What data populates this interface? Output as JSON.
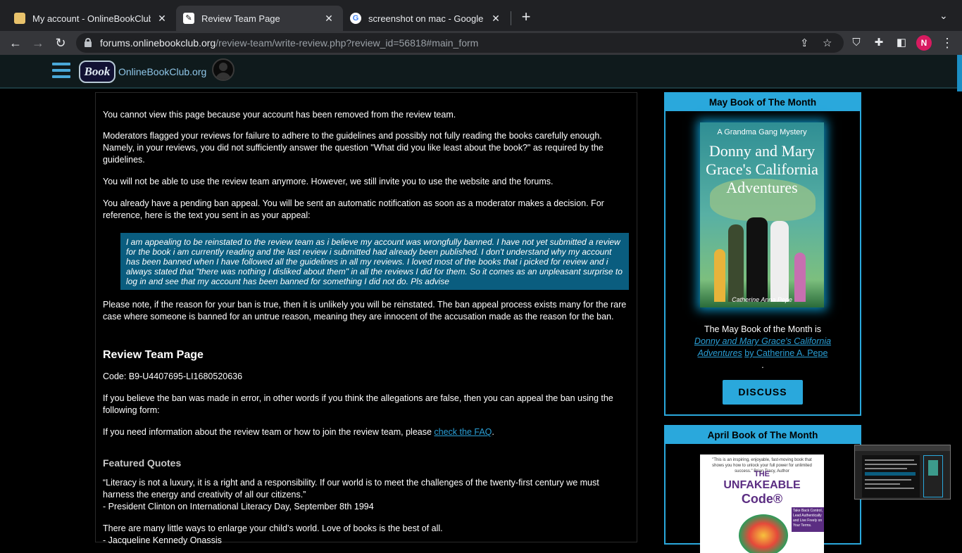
{
  "browser": {
    "tabs": [
      {
        "title": "My account - OnlineBookClub.o",
        "favicon": "book-icon",
        "active": false
      },
      {
        "title": "Review Team Page",
        "favicon": "quill-icon",
        "active": true
      },
      {
        "title": "screenshot on mac - Google S",
        "favicon": "google-icon",
        "active": false
      }
    ],
    "url_host": "forums.onlinebookclub.org",
    "url_path": "/review-team/write-review.php?review_id=56818#main_form",
    "profile_initial": "N"
  },
  "site": {
    "logo_text": "Book",
    "name": "OnlineBookClub.org"
  },
  "main": {
    "p1": "You cannot view this page because your account has been removed from the review team.",
    "p2": "Moderators flagged your reviews for failure to adhere to the guidelines and possibly not fully reading the books carefully enough. Namely, in your reviews, you did not sufficiently answer the question \"What did you like least about the book?\" as required by the guidelines.",
    "p3": "You will not be able to use the review team anymore. However, we still invite you to use the website and the forums.",
    "p4": "You already have a pending ban appeal. You will be sent an automatic notification as soon as a moderator makes a decision. For reference, here is the text you sent in as your appeal:",
    "appeal": "I am appealing to be reinstated to the review team as i believe my account was wrongfully banned. I have not yet submitted a review for the book i am currently reading and the last review i submitted had already been published. I don't understand why my account has been banned when I have followed all the guidelines in all my reviews. I loved most of the books that i picked for review and i always stated that \"there was nothing I disliked about them\" in all the reviews I did for them. So it comes as an unpleasant surprise to log in and see that my account has been banned for something I did not do. Pls advise",
    "p5": "Please note, if the reason for your ban is true, then it is unlikely you will be reinstated. The ban appeal process exists many for the rare case where someone is banned for an untrue reason, meaning they are innocent of the accusation made as the reason for the ban.",
    "heading": "Review Team Page",
    "code": "Code: B9-U4407695-LI1680520636",
    "p6": "If you believe the ban was made in error, in other words if you think the allegations are false, then you can appeal the ban using the following form:",
    "p7_prefix": "If you need information about the review team or how to join the review team, please ",
    "p7_link": "check the FAQ",
    "p7_suffix": ".",
    "quotes_heading": "Featured Quotes",
    "quote1": "“Literacy is not a luxury, it is a right and a responsibility. If our world is to meet the challenges of the twenty-first century we must harness the energy and creativity of all our citizens.”",
    "quote1_author": "- President Clinton on International Literacy Day, September 8th 1994",
    "quote2": "There are many little ways to enlarge your child’s world. Love of books is the best of all.",
    "quote2_author": "- Jacqueline Kennedy Onassis"
  },
  "sidebar": {
    "may": {
      "header": "May Book of The Month",
      "cover_tag": "A Grandma Gang Mystery",
      "cover_title": "Donny and Mary Grace's California Adventures",
      "cover_author": "Catherine Anna Pepe",
      "caption_prefix": "The May Book of the Month is",
      "book_link": "Donny and Mary Grace's California Adventures",
      "by_link": "by Catherine A. Pepe",
      "caption_suffix": ".",
      "button": "DISCUSS"
    },
    "april": {
      "header": "April Book of The Month",
      "cover_quote": "\"This is an inspiring, enjoyable, fast-moving book that shows you how to unlock your full power for unlimited success.\" Brian Tracy, Author",
      "cover_the": "THE",
      "cover_title1": "UNFAKEABLE",
      "cover_title2": "Code®",
      "cover_side": "Take Back Control, Lead Authentically and Live Freely on Your Terms."
    }
  },
  "colors": {
    "accent": "#2aa8dc",
    "appeal_bg": "#0a5d7f",
    "link": "#2a9fd6"
  }
}
